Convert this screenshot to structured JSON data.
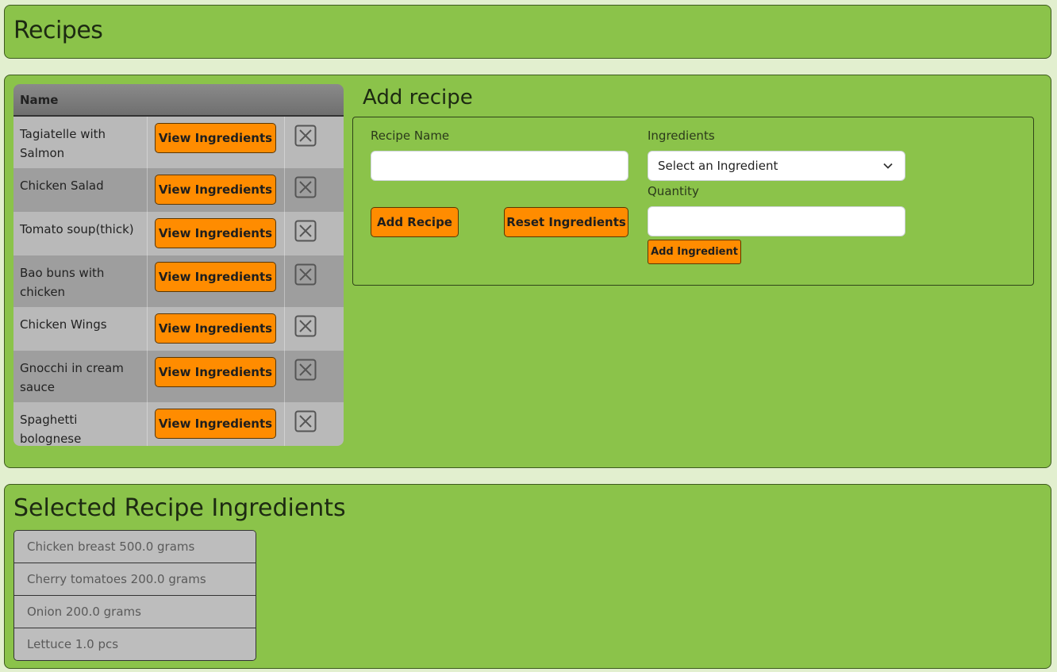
{
  "header": {
    "title": "Recipes"
  },
  "recipes_table": {
    "column_name": "Name",
    "view_label": "View Ingredients",
    "rows": [
      {
        "name": "Tagiatelle with Salmon"
      },
      {
        "name": "Chicken Salad"
      },
      {
        "name": "Tomato soup(thick)"
      },
      {
        "name": "Bao buns with chicken"
      },
      {
        "name": "Chicken Wings"
      },
      {
        "name": "Gnocchi in cream sauce"
      },
      {
        "name": "Spaghetti bolognese"
      }
    ],
    "delete_icon": "close-box-icon"
  },
  "add_recipe": {
    "title": "Add recipe",
    "recipe_name_label": "Recipe Name",
    "recipe_name_value": "",
    "ingredients_label": "Ingredients",
    "ingredient_select_value": "Select an Ingredient",
    "quantity_label": "Quantity",
    "quantity_value": "",
    "add_recipe_button": "Add Recipe",
    "reset_button": "Reset Ingredients",
    "add_ingredient_button": "Add Ingredient"
  },
  "selected_ingredients": {
    "title": "Selected Recipe Ingredients",
    "items": [
      "Chicken breast 500.0 grams",
      "Cherry tomatoes 200.0 grams",
      "Onion 200.0 grams",
      "Lettuce 1.0 pcs"
    ]
  },
  "colors": {
    "panel": "#8bc34a",
    "background": "#e2efcf",
    "button": "#ff8c00"
  }
}
